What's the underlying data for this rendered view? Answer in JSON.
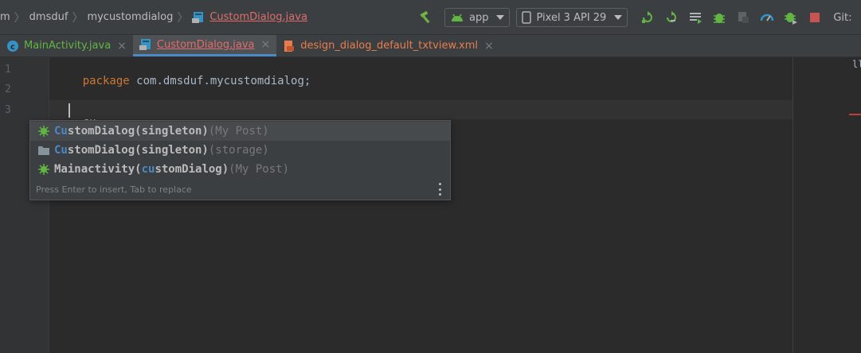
{
  "breadcrumb": {
    "items": [
      {
        "label": "m"
      },
      {
        "label": "dmsduf"
      },
      {
        "label": "mycustomdialog"
      },
      {
        "label": "CustomDialog.java",
        "icon": "java-class-icon"
      }
    ],
    "separator": "〉"
  },
  "toolbar": {
    "build_icon": "hammer-icon",
    "run_config": "app",
    "device": "Pixel 3 API 29",
    "buttons": [
      "apply-changes-icon",
      "apply-code-changes-icon",
      "coverage-icon",
      "debug-icon",
      "profile-icon",
      "profiler-icon",
      "attach-debugger-icon",
      "stop-icon"
    ],
    "git_label": "Git:"
  },
  "tabs": [
    {
      "label": "MainActivity.java",
      "icon": "class-c-icon",
      "color": "#62b543"
    },
    {
      "label": "CustomDialog.java",
      "icon": "java-class-icon",
      "color": "#e06c6c",
      "active": true
    },
    {
      "label": "design_dialog_default_txtview.xml",
      "icon": "xml-layout-icon",
      "color": "#e87c4d"
    }
  ],
  "editor": {
    "line_numbers": [
      "1",
      "2",
      "3"
    ],
    "line1": {
      "keyword": "package",
      "rest": " com.dmsduf.mycustomdialog;"
    },
    "line3": {
      "text": "cu"
    }
  },
  "completion": {
    "items": [
      {
        "match": "Cu",
        "name": "stomDialog(singleton)",
        "tail": "(My Post)",
        "icon": "bug-green-icon"
      },
      {
        "match": "Cu",
        "name": "stomDialog(singleton)",
        "tail": "(storage)",
        "icon": "folder-icon"
      },
      {
        "prefix": "Mainactivity(",
        "match": "cu",
        "name": "stomDialog)",
        "tail": "(My Post)",
        "icon": "bug-green-icon"
      }
    ],
    "hint": "Press Enter to insert, Tab to replace"
  },
  "colors": {
    "accent_blue": "#4a88c7",
    "keyword_orange": "#cc7832",
    "android_green": "#62b543",
    "error_red": "#e06c6c"
  }
}
